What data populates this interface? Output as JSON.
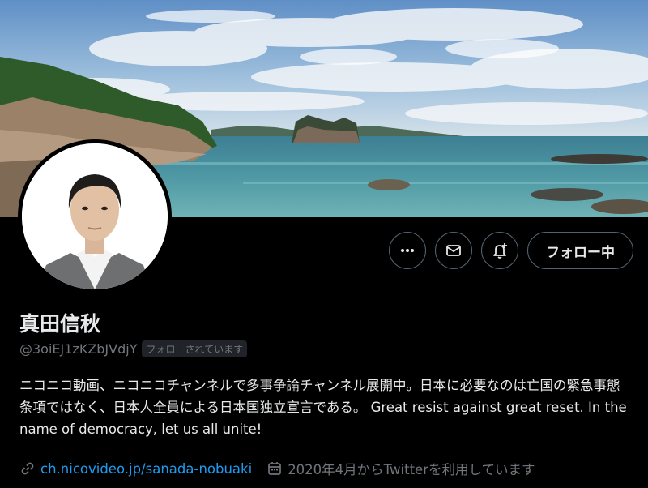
{
  "profile": {
    "display_name": "真田信秋",
    "handle": "@3oiEJ1zKZbJVdjY",
    "follows_you_badge": "フォローされています",
    "bio": "ニコニコ動画、ニコニコチャンネルで多事争論チャンネル展開中。日本に必要なのは亡国の緊急事態条項ではなく、日本人全員による日本国独立宣言である。 Great resist against great reset. In the name of democracy, let us all unite!",
    "website": "ch.nicovideo.jp/sanada-nobuaki",
    "joined": "2020年4月からTwitterを利用しています"
  },
  "actions": {
    "follow_button_label": "フォロー中"
  },
  "icons": {
    "more": "more-horizontal-icon",
    "message": "envelope-icon",
    "notify": "bell-plus-icon",
    "link": "link-icon",
    "calendar": "calendar-icon"
  },
  "colors": {
    "background": "#000000",
    "text_primary": "#e7e9ea",
    "text_secondary": "#71767b",
    "link": "#1d9bf0",
    "button_border": "#536471"
  }
}
